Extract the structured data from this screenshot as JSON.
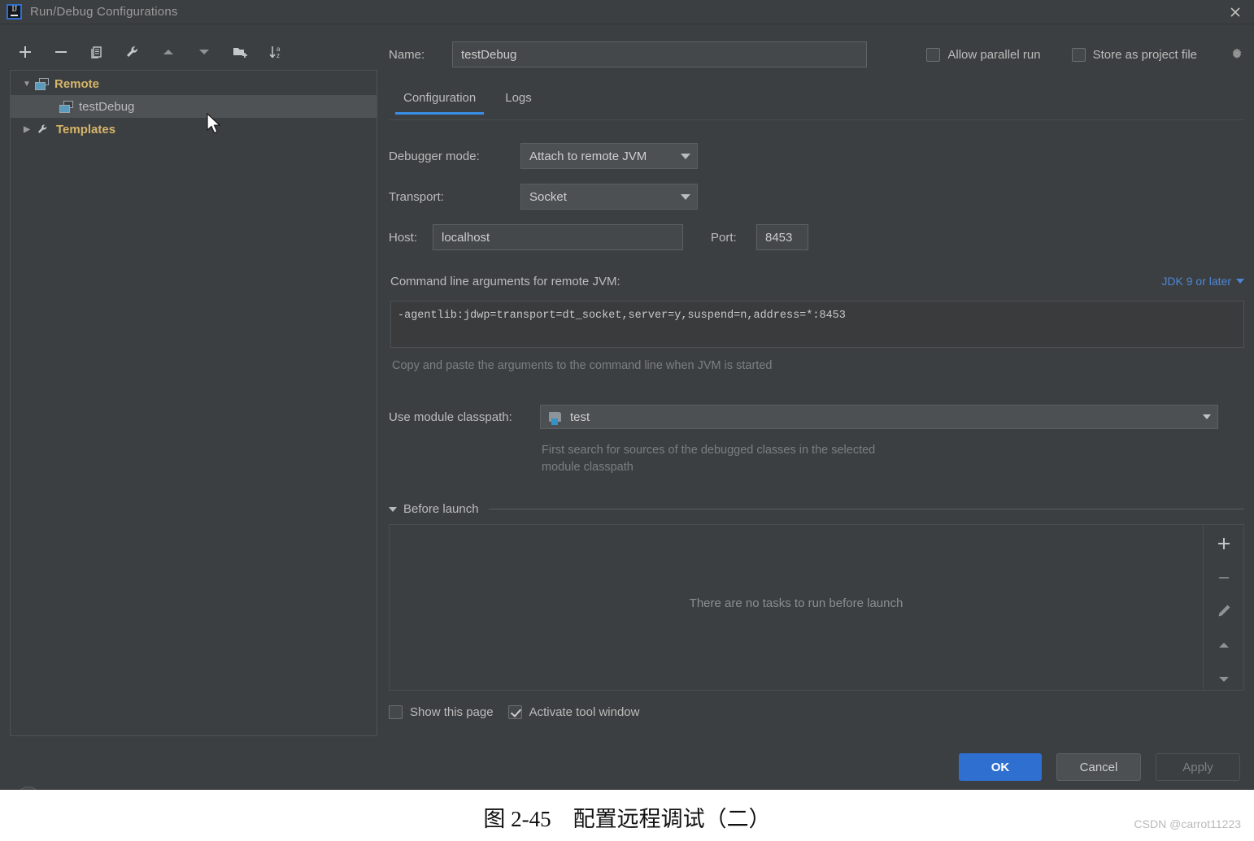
{
  "window": {
    "title": "Run/Debug Configurations",
    "logo_icon": "intellij-idea-logo",
    "close_icon": "close-icon"
  },
  "left_panel": {
    "toolbar": [
      {
        "name": "add-configuration-button",
        "icon": "plus-icon"
      },
      {
        "name": "remove-configuration-button",
        "icon": "minus-icon"
      },
      {
        "name": "copy-configuration-button",
        "icon": "copy-icon"
      },
      {
        "name": "edit-templates-button",
        "icon": "wrench-icon"
      },
      {
        "name": "move-up-button",
        "icon": "triangle-up-icon"
      },
      {
        "name": "move-down-button",
        "icon": "triangle-down-icon"
      },
      {
        "name": "new-folder-button",
        "icon": "folder-add-icon"
      },
      {
        "name": "sort-configurations-button",
        "icon": "sort-az-icon"
      }
    ],
    "tree": [
      {
        "label": "Remote",
        "type": "group",
        "expanded": true,
        "icon": "remote-config-icon",
        "selected": false
      },
      {
        "label": "testDebug",
        "type": "child",
        "expanded": null,
        "icon": "remote-config-icon",
        "selected": true
      },
      {
        "label": "Templates",
        "type": "group",
        "expanded": false,
        "icon": "wrench-icon",
        "selected": false
      }
    ],
    "help_button_label": "?"
  },
  "header": {
    "name_label": "Name:",
    "name_value": "testDebug",
    "name_placeholder": "",
    "allow_parallel_run": {
      "label": "Allow parallel run",
      "checked": false
    },
    "store_as_project_file": {
      "label": "Store as project file",
      "checked": false
    },
    "settings_gear_icon": "gear-icon"
  },
  "tabs": [
    {
      "label": "Configuration",
      "active": true
    },
    {
      "label": "Logs",
      "active": false
    }
  ],
  "configuration": {
    "debugger_mode": {
      "label": "Debugger mode:",
      "value": "Attach to remote JVM"
    },
    "transport": {
      "label": "Transport:",
      "value": "Socket"
    },
    "host": {
      "label": "Host:",
      "value": "localhost"
    },
    "port": {
      "label": "Port:",
      "value": "8453"
    },
    "command_line": {
      "label": "Command line arguments for remote JVM:",
      "jdk_link": "JDK 9 or later",
      "value": "-agentlib:jdwp=transport=dt_socket,server=y,suspend=n,address=*:8453",
      "hint": "Copy and paste the arguments to the command line when JVM is started"
    },
    "module_classpath": {
      "label": "Use module classpath:",
      "value": "test",
      "icon": "module-icon",
      "hint_line1": "First search for sources of the debugged classes in the selected",
      "hint_line2": "module classpath"
    }
  },
  "before_launch": {
    "title": "Before launch",
    "empty_text": "There are no tasks to run before launch",
    "tools": [
      {
        "name": "add-task-button",
        "icon": "plus-icon"
      },
      {
        "name": "remove-task-button",
        "icon": "minus-icon"
      },
      {
        "name": "edit-task-button",
        "icon": "pencil-icon"
      },
      {
        "name": "move-task-up-button",
        "icon": "triangle-up-icon"
      },
      {
        "name": "move-task-down-button",
        "icon": "triangle-down-icon"
      }
    ],
    "show_this_page": {
      "label": "Show this page",
      "checked": false
    },
    "activate_tool_window": {
      "label": "Activate tool window",
      "checked": true
    }
  },
  "footer": {
    "ok": "OK",
    "cancel": "Cancel",
    "apply": "Apply"
  },
  "caption": {
    "text": "图 2-45　配置远程调试（二）",
    "watermark": "CSDN @carrot11223"
  },
  "colors": {
    "dialog_bg": "#3c3f41",
    "accent_blue": "#2f6fd0",
    "tab_indicator": "#3a8ee6",
    "link": "#4d86d6",
    "group_label": "#d6b56a",
    "selection": "#4e5254"
  }
}
